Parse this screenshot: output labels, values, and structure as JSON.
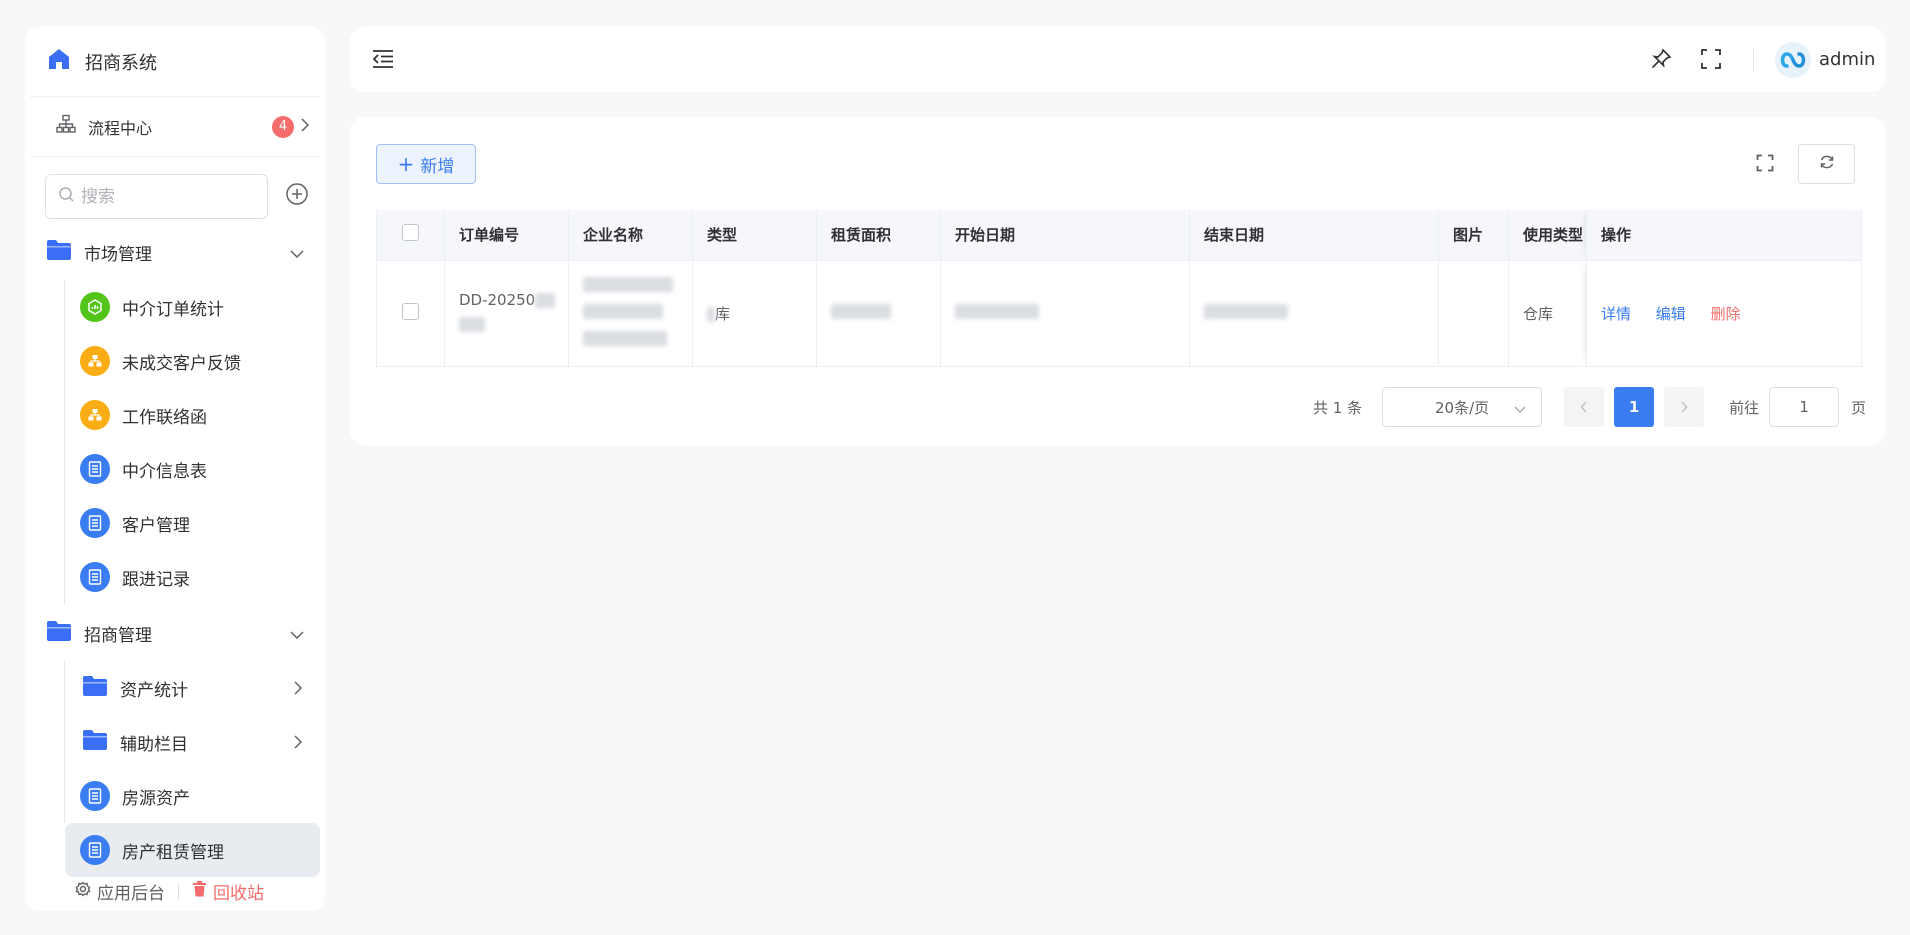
{
  "sidebar": {
    "app_title": "招商系统",
    "flow_center": {
      "label": "流程中心",
      "badge": "4"
    },
    "search": {
      "placeholder": "搜索"
    },
    "groups": [
      {
        "label": "市场管理",
        "items": [
          {
            "label": "中介订单统计",
            "icon": "chart-icon",
            "color": "#52c41a"
          },
          {
            "label": "未成交客户反馈",
            "icon": "org-icon",
            "color": "#faad14"
          },
          {
            "label": "工作联络函",
            "icon": "org-icon",
            "color": "#faad14"
          },
          {
            "label": "中介信息表",
            "icon": "form-icon",
            "color": "#3a7cf1"
          },
          {
            "label": "客户管理",
            "icon": "form-icon",
            "color": "#3a7cf1"
          },
          {
            "label": "跟进记录",
            "icon": "form-icon",
            "color": "#3a7cf1"
          }
        ]
      },
      {
        "label": "招商管理",
        "items": [
          {
            "label": "资产统计",
            "icon": "folder-icon"
          },
          {
            "label": "辅助栏目",
            "icon": "folder-icon"
          },
          {
            "label": "房源资产",
            "icon": "form-icon",
            "color": "#3a7cf1"
          },
          {
            "label": "房产租赁管理",
            "icon": "form-icon",
            "color": "#3a7cf1",
            "active": true
          }
        ]
      }
    ],
    "footer": {
      "app_admin": "应用后台",
      "recycle_bin": "回收站"
    }
  },
  "topbar": {
    "username": "admin"
  },
  "toolbar": {
    "add_label": "新增"
  },
  "table": {
    "columns": [
      "订单编号",
      "企业名称",
      "类型",
      "租赁面积",
      "开始日期",
      "结束日期",
      "图片",
      "使用类型",
      "操作"
    ],
    "rows": [
      {
        "order_no": "DD-20250",
        "type_fragment": "库",
        "usage_type": "仓库",
        "actions": {
          "detail": "详情",
          "edit": "编辑",
          "delete": "删除"
        }
      }
    ]
  },
  "pagination": {
    "total": "共 1 条",
    "page_size": "20条/页",
    "current_page": "1",
    "goto_label": "前往",
    "goto_value": "1",
    "page_unit": "页"
  },
  "colors": {
    "accent": "#3a7cf1",
    "danger": "#f56c6c",
    "success": "#52c41a",
    "warning": "#faad14"
  }
}
